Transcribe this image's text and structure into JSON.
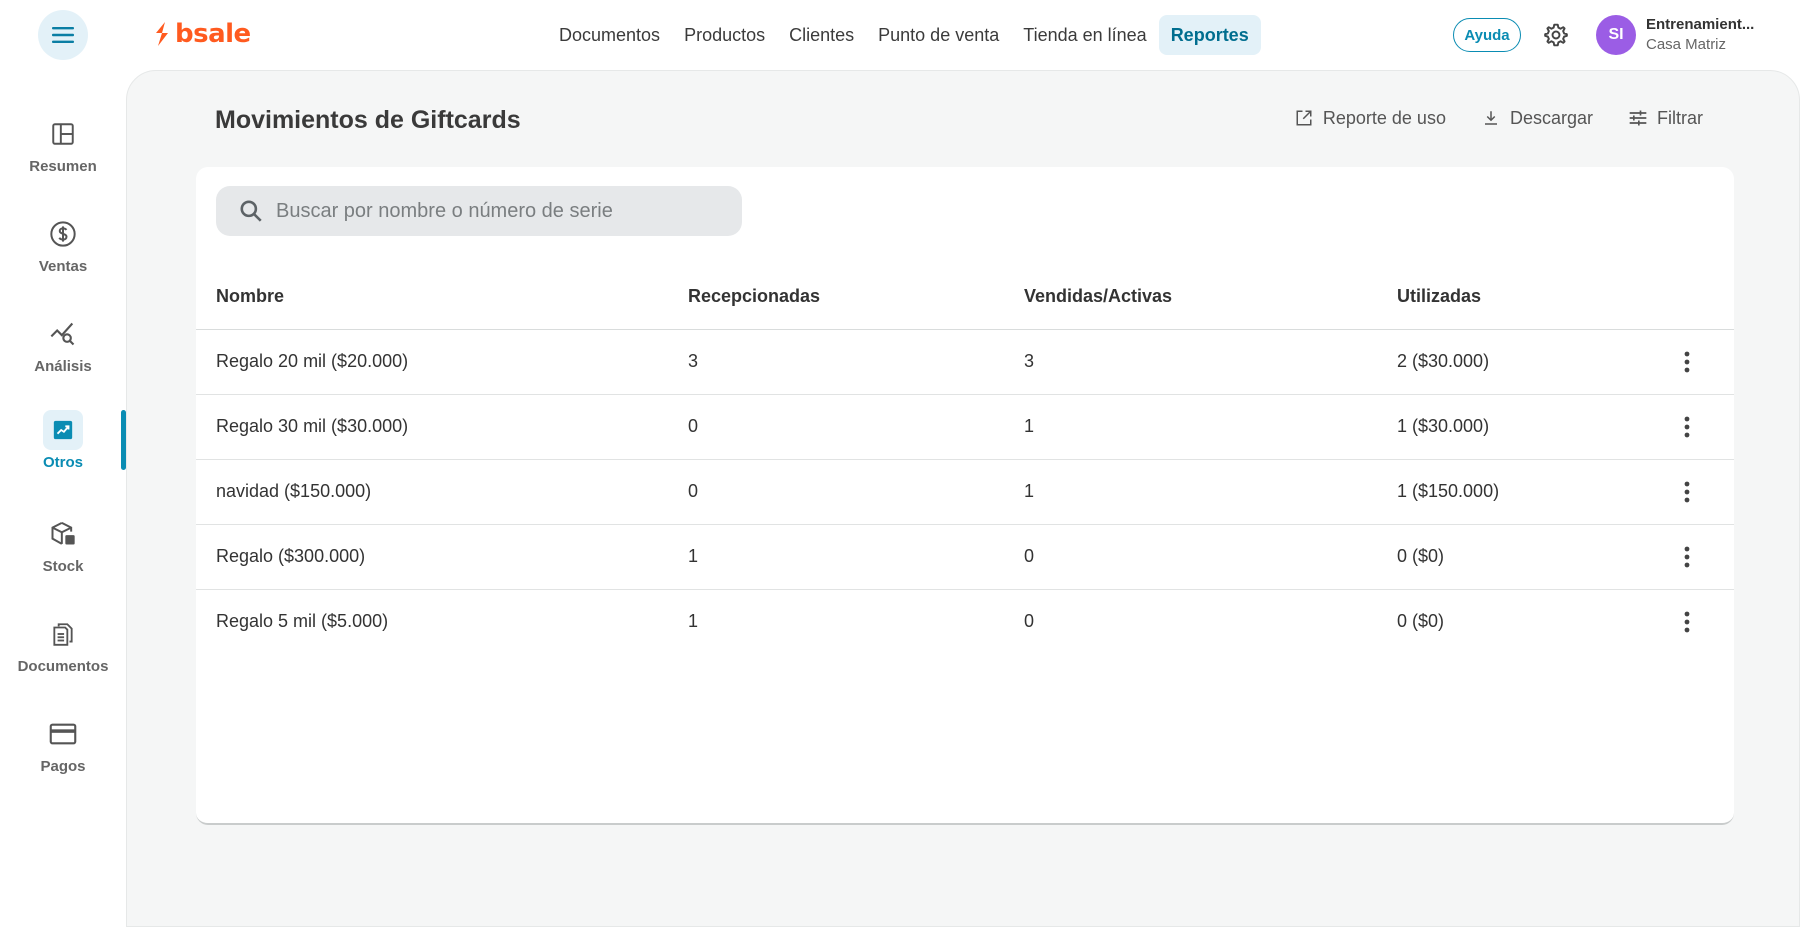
{
  "brand": {
    "name": "bsale",
    "color": "#ff5a1f",
    "accent": "#0a8cb3"
  },
  "header": {
    "menu_icon": "hamburger-menu-icon",
    "nav": [
      {
        "label": "Documentos",
        "active": false
      },
      {
        "label": "Productos",
        "active": false
      },
      {
        "label": "Clientes",
        "active": false
      },
      {
        "label": "Punto de venta",
        "active": false
      },
      {
        "label": "Tienda en línea",
        "active": false
      },
      {
        "label": "Reportes",
        "active": true
      }
    ],
    "help_label": "Ayuda",
    "settings_icon": "gear-icon",
    "user": {
      "initials": "SI",
      "name": "Entrenamient...",
      "branch": "Casa Matriz",
      "avatar_color": "#9b5de5"
    }
  },
  "sidebar": {
    "items": [
      {
        "label": "Resumen",
        "icon": "layout-panel-icon",
        "active": false
      },
      {
        "label": "Ventas",
        "icon": "dollar-circle-icon",
        "active": false
      },
      {
        "label": "Análisis",
        "icon": "chart-search-icon",
        "active": false
      },
      {
        "label": "Otros",
        "icon": "trending-up-icon",
        "active": true
      },
      {
        "label": "Stock",
        "icon": "box-stock-icon",
        "active": false
      },
      {
        "label": "Documentos",
        "icon": "documents-icon",
        "active": false
      },
      {
        "label": "Pagos",
        "icon": "credit-card-icon",
        "active": false
      }
    ]
  },
  "page": {
    "title": "Movimientos de Giftcards",
    "actions": [
      {
        "label": "Reporte de uso",
        "icon": "open-external-icon"
      },
      {
        "label": "Descargar",
        "icon": "download-icon"
      },
      {
        "label": "Filtrar",
        "icon": "filter-sliders-icon"
      }
    ],
    "search": {
      "placeholder": "Buscar por nombre o número de serie",
      "value": ""
    },
    "table": {
      "columns": [
        "Nombre",
        "Recepcionadas",
        "Vendidas/Activas",
        "Utilizadas"
      ],
      "rows": [
        {
          "nombre": "Regalo 20 mil ($20.000)",
          "recepcionadas": "3",
          "vendidas": "3",
          "utilizadas": "2 ($30.000)"
        },
        {
          "nombre": "Regalo 30 mil ($30.000)",
          "recepcionadas": "0",
          "vendidas": "1",
          "utilizadas": "1 ($30.000)"
        },
        {
          "nombre": "navidad ($150.000)",
          "recepcionadas": "0",
          "vendidas": "1",
          "utilizadas": "1 ($150.000)"
        },
        {
          "nombre": "Regalo ($300.000)",
          "recepcionadas": "1",
          "vendidas": "0",
          "utilizadas": "0 ($0)"
        },
        {
          "nombre": "Regalo 5 mil ($5.000)",
          "recepcionadas": "1",
          "vendidas": "0",
          "utilizadas": "0 ($0)"
        }
      ]
    }
  }
}
